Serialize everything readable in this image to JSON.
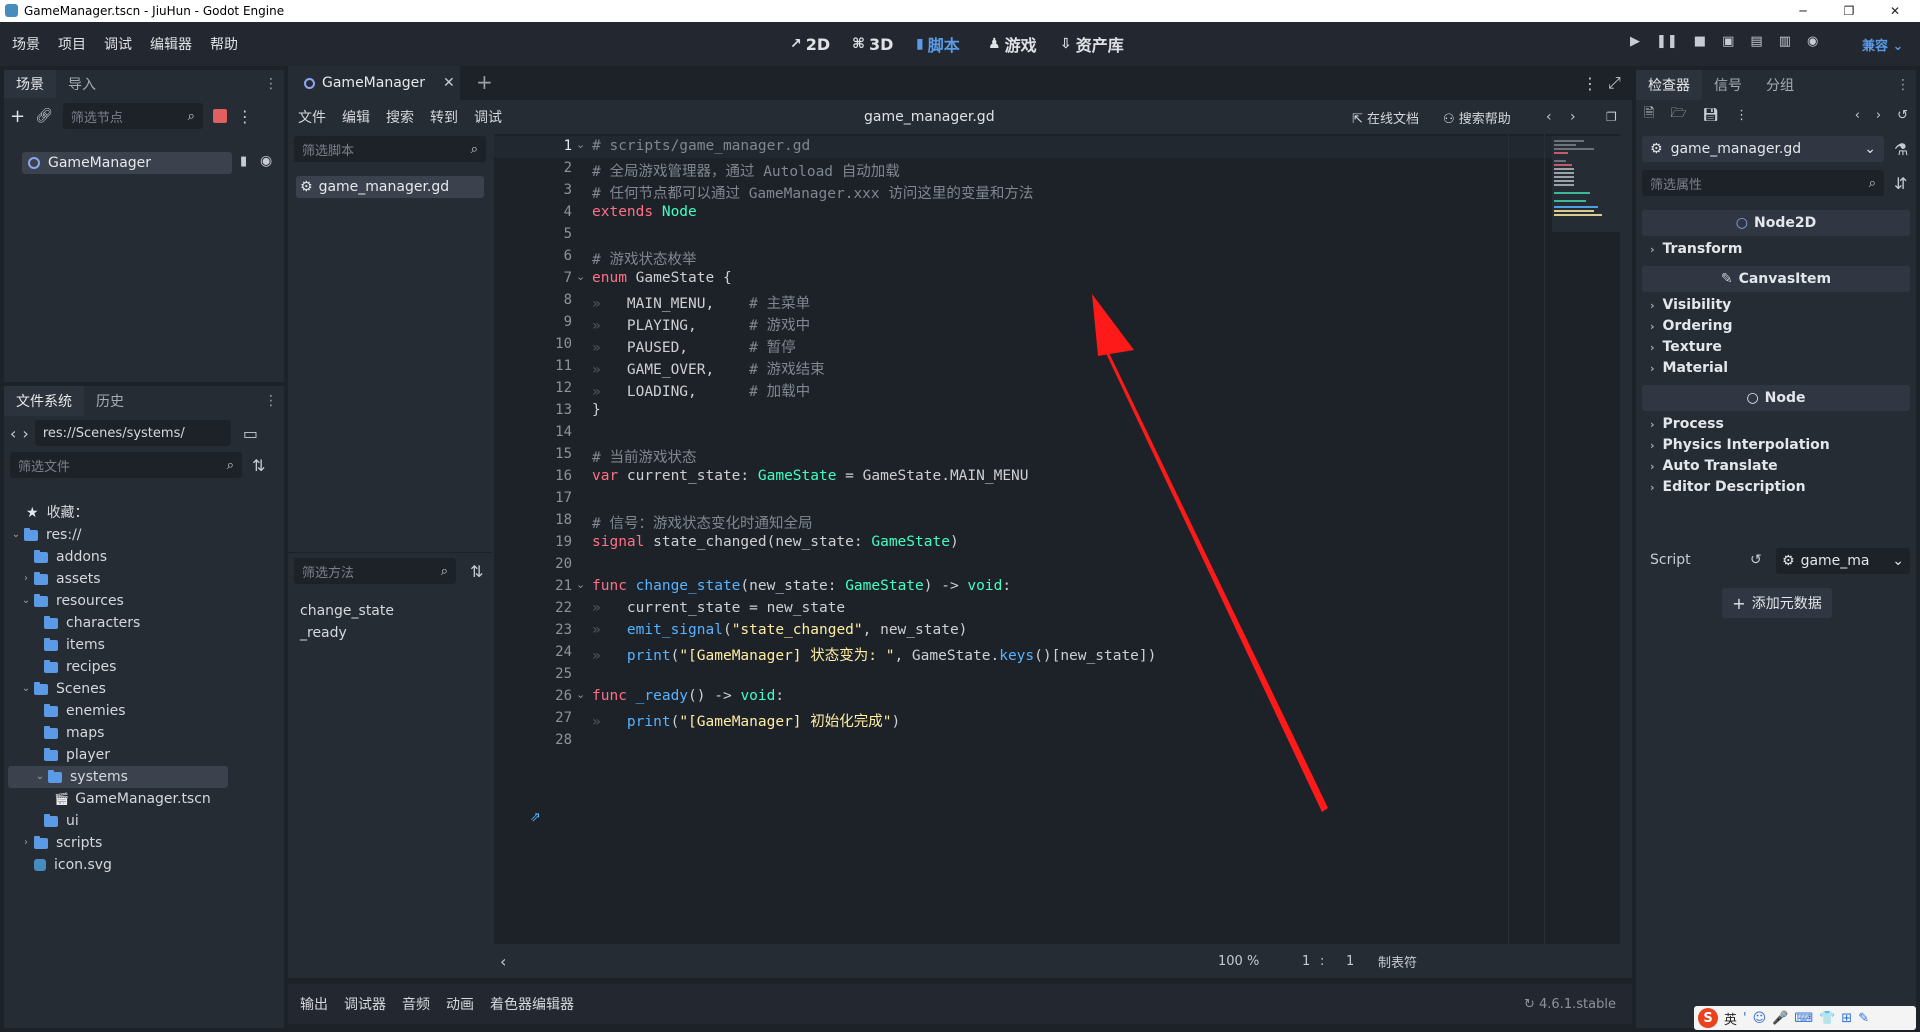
{
  "window": {
    "title": "GameManager.tscn - JiuHun - Godot Engine",
    "min": "─",
    "max": "❐",
    "close": "✕"
  },
  "menu": [
    "场景",
    "项目",
    "调试",
    "编辑器",
    "帮助"
  ],
  "workspaces": [
    {
      "icon": "↗",
      "label": "2D"
    },
    {
      "icon": "⌘",
      "label": "3D"
    },
    {
      "icon": "▮",
      "label": "脚本"
    },
    {
      "icon": "♟",
      "label": "游戏"
    },
    {
      "icon": "⇩",
      "label": "资产库"
    }
  ],
  "renderer": "兼容",
  "scene_dock": {
    "tabs": [
      "场景",
      "导入"
    ],
    "filter_placeholder": "筛选节点",
    "root_node": "GameManager"
  },
  "fs_dock": {
    "tabs": [
      "文件系统",
      "历史"
    ],
    "path": "res://Scenes/systems/",
    "filter_placeholder": "筛选文件",
    "favorites": "收藏：",
    "items": [
      {
        "label": "res://",
        "indent": 0,
        "chev": "⌄",
        "kind": "folder"
      },
      {
        "label": "addons",
        "indent": 1,
        "chev": "",
        "kind": "folder"
      },
      {
        "label": "assets",
        "indent": 1,
        "chev": "›",
        "kind": "folder"
      },
      {
        "label": "resources",
        "indent": 1,
        "chev": "⌄",
        "kind": "folder"
      },
      {
        "label": "characters",
        "indent": 2,
        "chev": "",
        "kind": "folder"
      },
      {
        "label": "items",
        "indent": 2,
        "chev": "",
        "kind": "folder"
      },
      {
        "label": "recipes",
        "indent": 2,
        "chev": "",
        "kind": "folder"
      },
      {
        "label": "Scenes",
        "indent": 1,
        "chev": "⌄",
        "kind": "folder"
      },
      {
        "label": "enemies",
        "indent": 2,
        "chev": "",
        "kind": "folder"
      },
      {
        "label": "maps",
        "indent": 2,
        "chev": "",
        "kind": "folder"
      },
      {
        "label": "player",
        "indent": 2,
        "chev": "",
        "kind": "folder"
      },
      {
        "label": "systems",
        "indent": 2,
        "chev": "⌄",
        "kind": "folder",
        "selected": true
      },
      {
        "label": "GameManager.tscn",
        "indent": 3,
        "chev": "",
        "kind": "scene"
      },
      {
        "label": "ui",
        "indent": 2,
        "chev": "",
        "kind": "folder"
      },
      {
        "label": "scripts",
        "indent": 1,
        "chev": "›",
        "kind": "folder"
      },
      {
        "label": "icon.svg",
        "indent": 1,
        "chev": "",
        "kind": "svg"
      }
    ]
  },
  "editor_tab": {
    "label": "GameManager",
    "add": "+"
  },
  "script_menu": [
    "文件",
    "编辑",
    "搜索",
    "转到",
    "调试"
  ],
  "script_file": "game_manager.gd",
  "online_docs": "在线文档",
  "search_help": "搜索帮助",
  "script_filter_placeholder": "筛选脚本",
  "script_list": [
    "game_manager.gd"
  ],
  "method_filter_placeholder": "筛选方法",
  "methods": [
    "change_state",
    "_ready"
  ],
  "code": [
    [
      [
        "cmt",
        "# scripts/game_manager.gd"
      ]
    ],
    [
      [
        "cmt",
        "# 全局游戏管理器，通过 Autoload 自动加载"
      ]
    ],
    [
      [
        "cmt",
        "# 任何节点都可以通过 GameManager.xxx 访问这里的变量和方法"
      ]
    ],
    [
      [
        "kw",
        "extends "
      ],
      [
        "ty",
        "Node"
      ]
    ],
    [],
    [
      [
        "cmt",
        "# 游戏状态枚举"
      ]
    ],
    [
      [
        "kw",
        "enum "
      ],
      [
        "",
        "GameState {"
      ]
    ],
    [
      [
        "tab",
        "»"
      ],
      [
        "",
        "   MAIN_MENU,    "
      ],
      [
        "cmt",
        "# 主菜单"
      ]
    ],
    [
      [
        "tab",
        "»"
      ],
      [
        "",
        "   PLAYING,      "
      ],
      [
        "cmt",
        "# 游戏中"
      ]
    ],
    [
      [
        "tab",
        "»"
      ],
      [
        "",
        "   PAUSED,       "
      ],
      [
        "cmt",
        "# 暂停"
      ]
    ],
    [
      [
        "tab",
        "»"
      ],
      [
        "",
        "   GAME_OVER,    "
      ],
      [
        "cmt",
        "# 游戏结束"
      ]
    ],
    [
      [
        "tab",
        "»"
      ],
      [
        "",
        "   LOADING,      "
      ],
      [
        "cmt",
        "# 加载中"
      ]
    ],
    [
      [
        "",
        "}"
      ]
    ],
    [],
    [
      [
        "cmt",
        "# 当前游戏状态"
      ]
    ],
    [
      [
        "kw",
        "var "
      ],
      [
        "",
        "current_state: "
      ],
      [
        "ty",
        "GameState"
      ],
      [
        "",
        " = GameState.MAIN_MENU"
      ]
    ],
    [],
    [
      [
        "cmt",
        "# 信号：游戏状态变化时通知全局"
      ]
    ],
    [
      [
        "kw",
        "signal "
      ],
      [
        "",
        "state_changed(new_state: "
      ],
      [
        "ty",
        "GameState"
      ],
      [
        "",
        ")"
      ]
    ],
    [],
    [
      [
        "kw",
        "func "
      ],
      [
        "fn",
        "change_state"
      ],
      [
        "",
        "(new_state: "
      ],
      [
        "ty",
        "GameState"
      ],
      [
        "",
        ") -> "
      ],
      [
        "ty",
        "void"
      ],
      [
        "",
        ":"
      ]
    ],
    [
      [
        "tab",
        "»"
      ],
      [
        "",
        "   current_state = new_state"
      ]
    ],
    [
      [
        "tab",
        "»"
      ],
      [
        "fn",
        "   emit_signal"
      ],
      [
        "",
        "("
      ],
      [
        "str",
        "\"state_changed\""
      ],
      [
        "",
        ", new_state)"
      ]
    ],
    [
      [
        "tab",
        "»"
      ],
      [
        "fn",
        "   print"
      ],
      [
        "",
        "("
      ],
      [
        "str",
        "\"[GameManager] 状态变为: \""
      ],
      [
        "",
        ", GameState."
      ],
      [
        "fn",
        "keys"
      ],
      [
        "",
        "()[new_state])"
      ]
    ],
    [],
    [
      [
        "kw",
        "func "
      ],
      [
        "fn",
        "_ready"
      ],
      [
        "",
        "() -> "
      ],
      [
        "ty",
        "void"
      ],
      [
        "",
        ":"
      ]
    ],
    [
      [
        "tab",
        "»"
      ],
      [
        "fn",
        "   print"
      ],
      [
        "",
        "("
      ],
      [
        "str",
        "\"[GameManager] 初始化完成\""
      ],
      [
        "",
        ")"
      ]
    ],
    []
  ],
  "fold_lines": [
    1,
    7,
    21,
    26
  ],
  "status": {
    "zoom": "100 %",
    "line": "1",
    "sep": ":",
    "col": "1",
    "indent": "制表符"
  },
  "bottom_tabs": [
    "输出",
    "调试器",
    "音频",
    "动画",
    "着色器编辑器"
  ],
  "version": "4.6.1.stable",
  "inspector": {
    "tabs": [
      "检查器",
      "信号",
      "分组"
    ],
    "resource": "game_manager.gd",
    "filter_placeholder": "筛选属性",
    "sections": [
      {
        "header": "Node2D",
        "icon": "○",
        "items": [
          "Transform"
        ]
      },
      {
        "header": "CanvasItem",
        "icon": "✎",
        "items": [
          "Visibility",
          "Ordering",
          "Texture",
          "Material"
        ]
      },
      {
        "header": "Node",
        "icon": "○",
        "items": [
          "Process",
          "Physics Interpolation",
          "Auto Translate",
          "Editor Description"
        ]
      }
    ],
    "script_label": "Script",
    "script_value": "game_ma",
    "add_metadata": "添加元数据"
  },
  "ime": {
    "lang": "英",
    "items": [
      "'",
      "☺",
      "🎤",
      "⌨",
      "👕",
      "⊞",
      "✎"
    ]
  },
  "colors": {
    "accent": "#5b9ae6",
    "comment": "#808790",
    "keyword": "#ff7085",
    "type": "#42ffc2",
    "function": "#57b3ff",
    "string": "#ffeda1",
    "arrow": "#ff1a1a"
  }
}
